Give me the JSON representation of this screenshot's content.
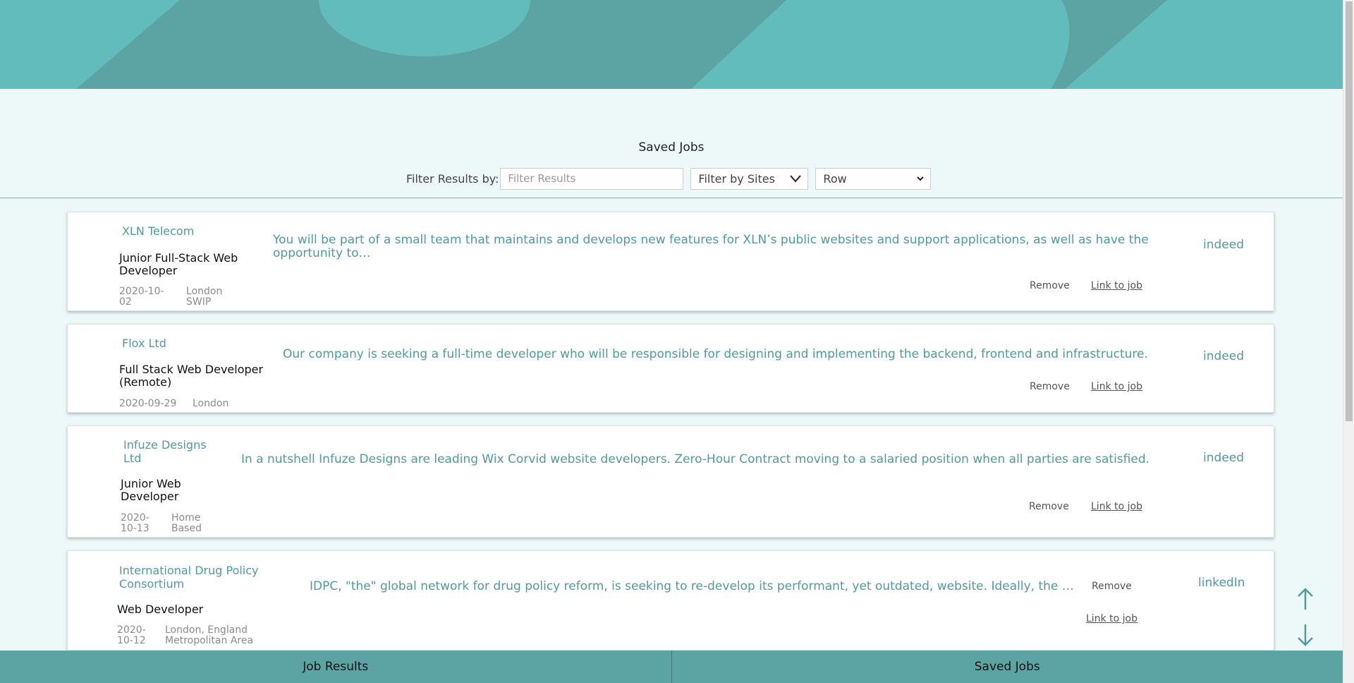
{
  "page": {
    "title": "Saved Jobs"
  },
  "filters": {
    "label": "Filter Results by:",
    "search_placeholder": "Filter Results",
    "sites_label": "Filter by Sites",
    "layout_value": "Row"
  },
  "jobs": [
    {
      "company": "XLN Telecom",
      "title": "Junior Full-Stack Web Developer",
      "date": "2020-10-02",
      "location": "London SWIP",
      "description": "You will be part of a small team that maintains and develops new features for XLN’s public websites and support applications, as well as have the opportunity to…",
      "remove_label": "Remove",
      "link_label": "Link to job",
      "site": "indeed"
    },
    {
      "company": "Flox Ltd",
      "title": "Full Stack Web Developer (Remote)",
      "date": "2020-09-29",
      "location": "London",
      "description": "Our company is seeking a full-time developer who will be responsible for designing and implementing the backend, frontend and infrastructure.",
      "remove_label": "Remove",
      "link_label": "Link to job",
      "site": "indeed"
    },
    {
      "company": "Infuze Designs Ltd",
      "title": "Junior Web Developer",
      "date": "2020-10-13",
      "location": "Home Based",
      "description": "In a nutshell Infuze Designs are leading Wix Corvid website developers. Zero-Hour Contract moving to a salaried position when all parties are satisfied.",
      "remove_label": "Remove",
      "link_label": "Link to job",
      "site": "indeed"
    },
    {
      "company": "International Drug Policy Consortium",
      "title": "Web Developer",
      "date": "2020-10-12",
      "location": "London, England Metropolitan Area",
      "description": "IDPC, \"the\" global network for drug policy reform, is seeking to re-develop its performant, yet outdated, website. Ideally, the …",
      "remove_label": "Remove",
      "link_label": "Link to job",
      "site": "linkedIn"
    }
  ],
  "bottom_nav": {
    "job_results": "Job Results",
    "saved_jobs": "Saved Jobs"
  },
  "icons": {
    "scroll_up": "arrow-up-icon",
    "scroll_down": "arrow-down-icon",
    "dropdown": "chevron-down-icon"
  },
  "colors": {
    "accent": "#5ba4a3",
    "banner": "#62bcbb",
    "background": "#edf9f8",
    "text_accent": "#4f9c9b"
  }
}
